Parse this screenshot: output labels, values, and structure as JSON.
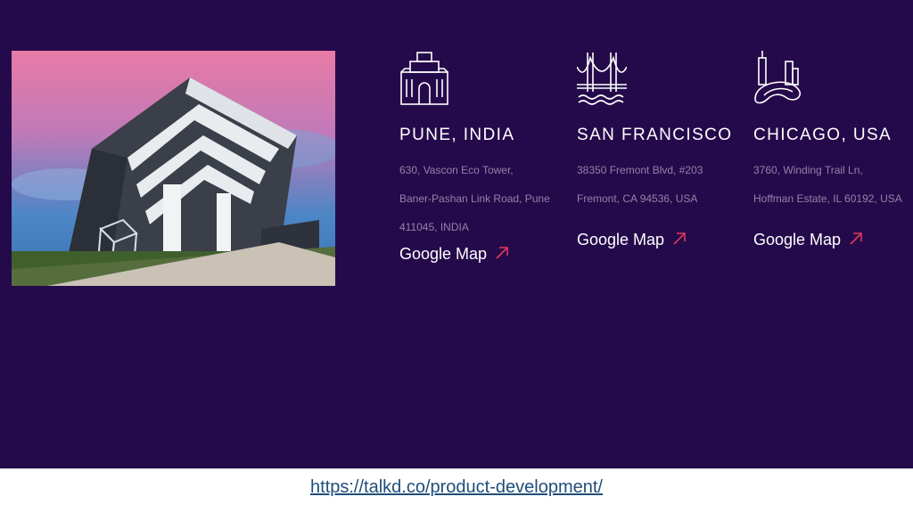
{
  "photo": {
    "watermark": ""
  },
  "offices": [
    {
      "icon": "fort-building-icon",
      "city": "PUNE, INDIA",
      "address_lines": [
        "630, Vascon Eco Tower,",
        "Baner-Pashan Link Road, Pune",
        "411045, INDIA"
      ],
      "map_label": "Google Map"
    },
    {
      "icon": "golden-gate-bridge-icon",
      "city": "SAN FRANCISCO",
      "address_lines": [
        "38350 Fremont Blvd, #203",
        "Fremont, CA 94536, USA"
      ],
      "map_label": "Google Map"
    },
    {
      "icon": "chicago-bean-skyline-icon",
      "city": "CHICAGO, USA",
      "address_lines": [
        "3760, Winding Trail Ln,",
        "Hoffman Estate, IL 60192, USA"
      ],
      "map_label": "Google Map"
    }
  ],
  "footer": {
    "url": "https://talkd.co/product-development/"
  },
  "colors": {
    "background": "#250a4b",
    "arrow": "#e0385b",
    "address": "#8f84a8",
    "link": "#1f4e79"
  }
}
